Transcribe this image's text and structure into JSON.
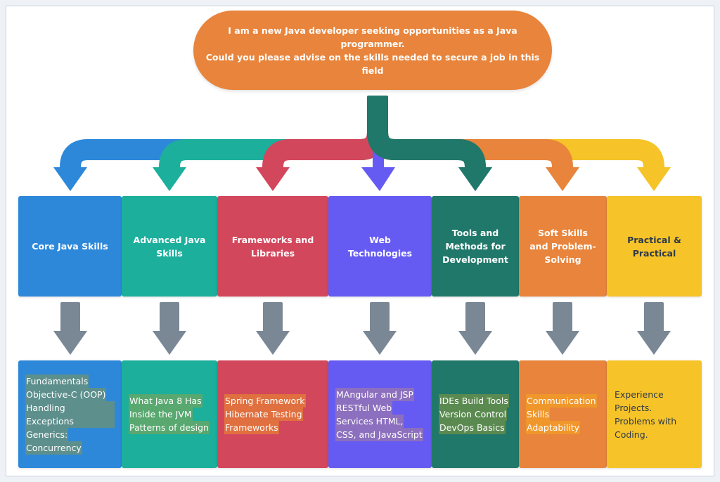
{
  "question": {
    "line1": "I am a new Java developer seeking opportunities as a Java programmer.",
    "line2": "Could you please advise on the skills needed to secure a job in this field"
  },
  "colors": {
    "question_bg": "#e8843b",
    "connector_arrow": "#7a8795",
    "page_bg": "#eef2f6"
  },
  "categories": [
    {
      "title": "Core Java Skills",
      "color": "#2d88d9",
      "highlight": "#5d8f8c",
      "items": [
        "Fundamentals",
        "Objective-C (OOP)",
        "Handling Exceptions",
        "Generics:",
        "Concurrency"
      ]
    },
    {
      "title": "Advanced Java Skills",
      "color": "#1baf9c",
      "highlight": "#58a86f",
      "items": [
        "What Java 8 Has",
        "Inside the JVM",
        "Patterns of design"
      ]
    },
    {
      "title": "Frameworks and Libraries",
      "color": "#d3475c",
      "highlight": "#e0703f",
      "items": [
        "Spring Framework",
        "Hibernate  Testing",
        "Frameworks"
      ]
    },
    {
      "title": "Web Technologies",
      "color": "#655bf3",
      "highlight": "#8c6fbe",
      "items": [
        "MAngular and JSP",
        "RESTful Web",
        "Services HTML,",
        "CSS, and JavaScript"
      ]
    },
    {
      "title": "Tools and Methods for Development",
      "color": "#20786a",
      "highlight": "#5a8a50",
      "items": [
        "IDEs Build Tools",
        "Version Control",
        "DevOps Basics"
      ]
    },
    {
      "title": "Soft Skills and Problem-Solving",
      "color": "#e8843b",
      "highlight": "#f0972c",
      "items": [
        "Communication",
        "Skills",
        "Adaptability"
      ]
    },
    {
      "title": "Practical & Practical",
      "color": "#f6c328",
      "highlight": "",
      "items": [
        "Experience",
        "Projects.",
        "Problems with",
        "Coding."
      ]
    }
  ]
}
